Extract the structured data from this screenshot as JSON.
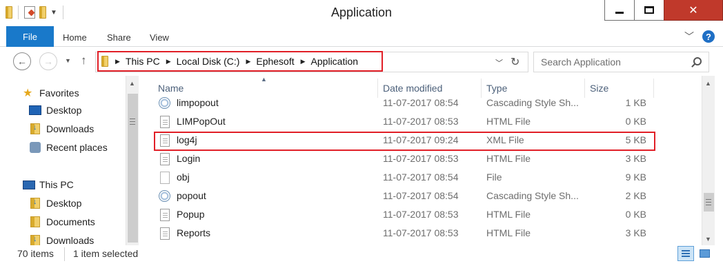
{
  "window": {
    "title": "Application",
    "close_glyph": "✕"
  },
  "ribbon": {
    "file_tab": "File",
    "tabs": [
      "Home",
      "Share",
      "View"
    ],
    "help": "?"
  },
  "navbar": {
    "breadcrumb": [
      "This PC",
      "Local Disk (C:)",
      "Ephesoft",
      "Application"
    ],
    "search_placeholder": "Search Application"
  },
  "navpane": {
    "favorites": {
      "label": "Favorites",
      "items": [
        "Desktop",
        "Downloads",
        "Recent places"
      ]
    },
    "this_pc": {
      "label": "This PC",
      "items": [
        "Desktop",
        "Documents",
        "Downloads"
      ]
    }
  },
  "filelist": {
    "columns": {
      "name": "Name",
      "date": "Date modified",
      "type": "Type",
      "size": "Size"
    },
    "rows": [
      {
        "name": "limpopout",
        "date": "11-07-2017 08:54",
        "type": "Cascading Style Sh...",
        "size": "1 KB",
        "icon": "css-file-icon"
      },
      {
        "name": "LIMPopOut",
        "date": "11-07-2017 08:53",
        "type": "HTML File",
        "size": "0 KB",
        "icon": "html-file-icon"
      },
      {
        "name": "log4j",
        "date": "11-07-2017 09:24",
        "type": "XML File",
        "size": "5 KB",
        "icon": "xml-file-icon",
        "selected": true
      },
      {
        "name": "Login",
        "date": "11-07-2017 08:53",
        "type": "HTML File",
        "size": "3 KB",
        "icon": "html-file-icon"
      },
      {
        "name": "obj",
        "date": "11-07-2017 08:54",
        "type": "File",
        "size": "9 KB",
        "icon": "blank-file-icon"
      },
      {
        "name": "popout",
        "date": "11-07-2017 08:54",
        "type": "Cascading Style Sh...",
        "size": "2 KB",
        "icon": "css-file-icon"
      },
      {
        "name": "Popup",
        "date": "11-07-2017 08:53",
        "type": "HTML File",
        "size": "0 KB",
        "icon": "html-file-icon"
      },
      {
        "name": "Reports",
        "date": "11-07-2017 08:53",
        "type": "HTML File",
        "size": "3 KB",
        "icon": "html-file-icon"
      }
    ]
  },
  "statusbar": {
    "item_count": "70 items",
    "selection": "1 item selected"
  },
  "colors": {
    "file_tab": "#1979ca",
    "close_button": "#c0392b",
    "highlight_box": "#e11e26",
    "header_text": "#4c607a"
  }
}
